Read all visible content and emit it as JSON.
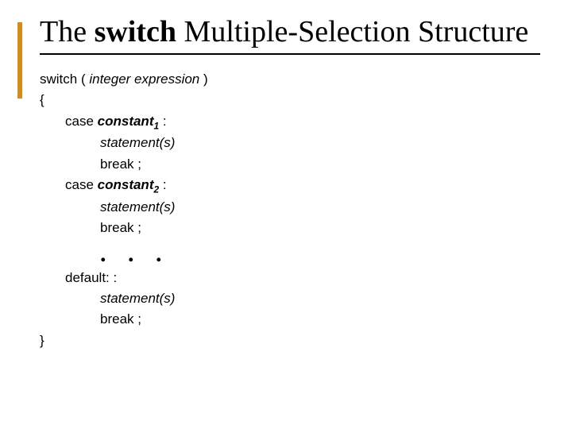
{
  "title": {
    "pre": "The ",
    "keyword": "switch",
    "post": " Multiple-Selection Structure"
  },
  "code": {
    "l1_a": "switch ( ",
    "l1_b": "integer expression",
    "l1_c": " )",
    "l2": "{",
    "l3_a": "case ",
    "l3_b": "constant",
    "l3_sub": "1",
    "l3_c": " :",
    "l4": "statement(s)",
    "l5": "break ;",
    "l6_a": "case ",
    "l6_b": "constant",
    "l6_sub": "2",
    "l6_c": " :",
    "l7": "statement(s)",
    "l8": "break ;",
    "ellipsis": ". . .",
    "l9": "default: :",
    "l10": "statement(s)",
    "l11": "break ;",
    "l12": "}"
  }
}
